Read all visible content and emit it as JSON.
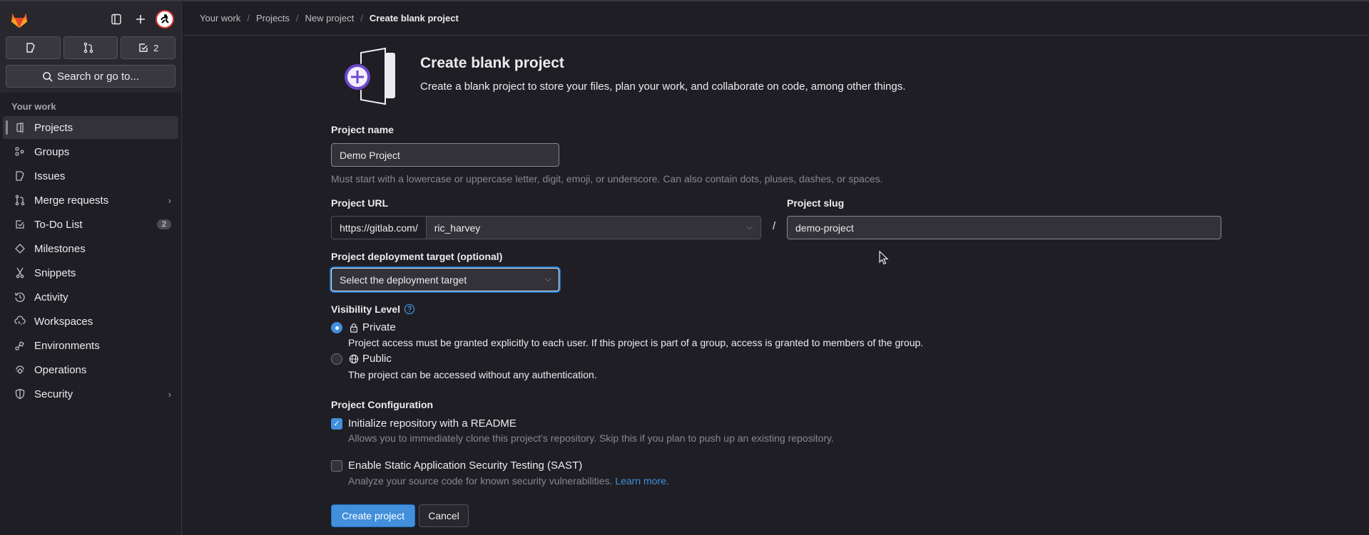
{
  "sidebar": {
    "counters": [
      {
        "icon": "issues-icon",
        "count": ""
      },
      {
        "icon": "merge-request-icon",
        "count": ""
      },
      {
        "icon": "todo-icon",
        "count": "2"
      }
    ],
    "search_label": "Search or go to...",
    "section_title": "Your work",
    "items": [
      {
        "label": "Projects",
        "icon": "project-icon",
        "active": true
      },
      {
        "label": "Groups",
        "icon": "group-icon"
      },
      {
        "label": "Issues",
        "icon": "issues-icon"
      },
      {
        "label": "Merge requests",
        "icon": "merge-request-icon",
        "has_submenu": true
      },
      {
        "label": "To-Do List",
        "icon": "todo-icon",
        "badge": "2"
      },
      {
        "label": "Milestones",
        "icon": "milestone-icon"
      },
      {
        "label": "Snippets",
        "icon": "snippet-icon"
      },
      {
        "label": "Activity",
        "icon": "history-icon"
      },
      {
        "label": "Workspaces",
        "icon": "workspace-icon"
      },
      {
        "label": "Environments",
        "icon": "environment-icon"
      },
      {
        "label": "Operations",
        "icon": "operations-icon"
      },
      {
        "label": "Security",
        "icon": "shield-icon",
        "has_submenu": true
      }
    ]
  },
  "breadcrumb": [
    "Your work",
    "Projects",
    "New project",
    "Create blank project"
  ],
  "header": {
    "title": "Create blank project",
    "description": "Create a blank project to store your files, plan your work, and collaborate on code, among other things."
  },
  "form": {
    "project_name": {
      "label": "Project name",
      "value": "Demo Project",
      "help": "Must start with a lowercase or uppercase letter, digit, emoji, or underscore. Can also contain dots, pluses, dashes, or spaces."
    },
    "project_url": {
      "label": "Project URL",
      "prefix": "https://gitlab.com/",
      "namespace": "ric_harvey",
      "separator": "/"
    },
    "project_slug": {
      "label": "Project slug",
      "value": "demo-project"
    },
    "deployment_target": {
      "label": "Project deployment target (optional)",
      "selected": "Select the deployment target"
    },
    "visibility": {
      "label": "Visibility Level",
      "options": [
        {
          "label": "Private",
          "icon": "lock-icon",
          "selected": true,
          "description": "Project access must be granted explicitly to each user. If this project is part of a group, access is granted to members of the group."
        },
        {
          "label": "Public",
          "icon": "globe-icon",
          "selected": false,
          "description": "The project can be accessed without any authentication."
        }
      ]
    },
    "configuration": {
      "label": "Project Configuration",
      "options": [
        {
          "label": "Initialize repository with a README",
          "checked": true,
          "description": "Allows you to immediately clone this project’s repository. Skip this if you plan to push up an existing repository."
        },
        {
          "label": "Enable Static Application Security Testing (SAST)",
          "checked": false,
          "description": "Analyze your source code for known security vulnerabilities.",
          "link": "Learn more."
        }
      ]
    },
    "submit_label": "Create project",
    "cancel_label": "Cancel"
  },
  "colors": {
    "accent": "#428fdc",
    "background": "#1f1e24",
    "sidebar_top": "#28272d",
    "hero_purple": "#6e49cb"
  }
}
